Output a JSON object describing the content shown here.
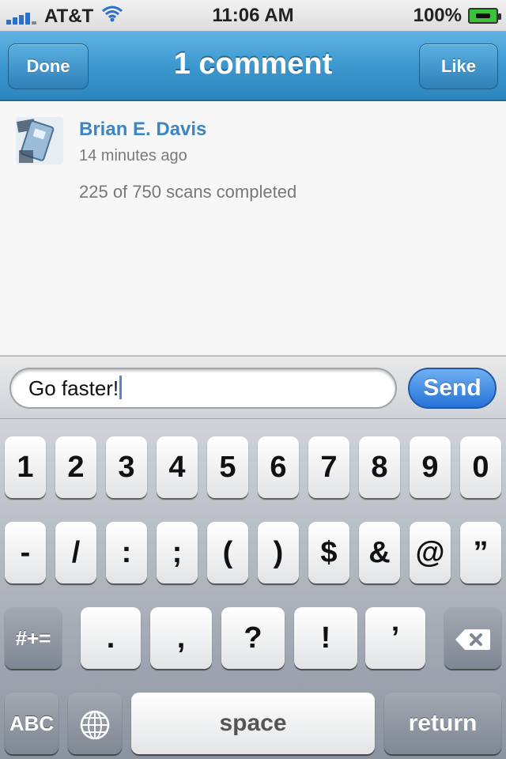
{
  "status_bar": {
    "carrier": "AT&T",
    "time": "11:06 AM",
    "battery_percent": "100%",
    "icons": [
      "signal-icon",
      "wifi-icon",
      "battery-charging-icon"
    ]
  },
  "nav": {
    "title": "1 comment",
    "left_button": "Done",
    "right_button": "Like",
    "bar_color": "#3d98cf"
  },
  "comments": [
    {
      "author": "Brian E. Davis",
      "time": "14 minutes ago",
      "text": "225 of 750 scans completed",
      "avatar_icon": "user-avatar-icon"
    }
  ],
  "composer": {
    "value": "Go faster!",
    "send_label": "Send"
  },
  "keyboard": {
    "row1": [
      "1",
      "2",
      "3",
      "4",
      "5",
      "6",
      "7",
      "8",
      "9",
      "0"
    ],
    "row2": [
      "-",
      "/",
      ":",
      ";",
      "(",
      ")",
      "$",
      "&",
      "@",
      "”"
    ],
    "row3": [
      "#+=",
      ".",
      ",",
      "?",
      "!",
      "’"
    ],
    "row4": {
      "abc": "ABC",
      "space": "space",
      "return": "return"
    },
    "icons": [
      "globe-icon",
      "backspace-icon"
    ]
  }
}
